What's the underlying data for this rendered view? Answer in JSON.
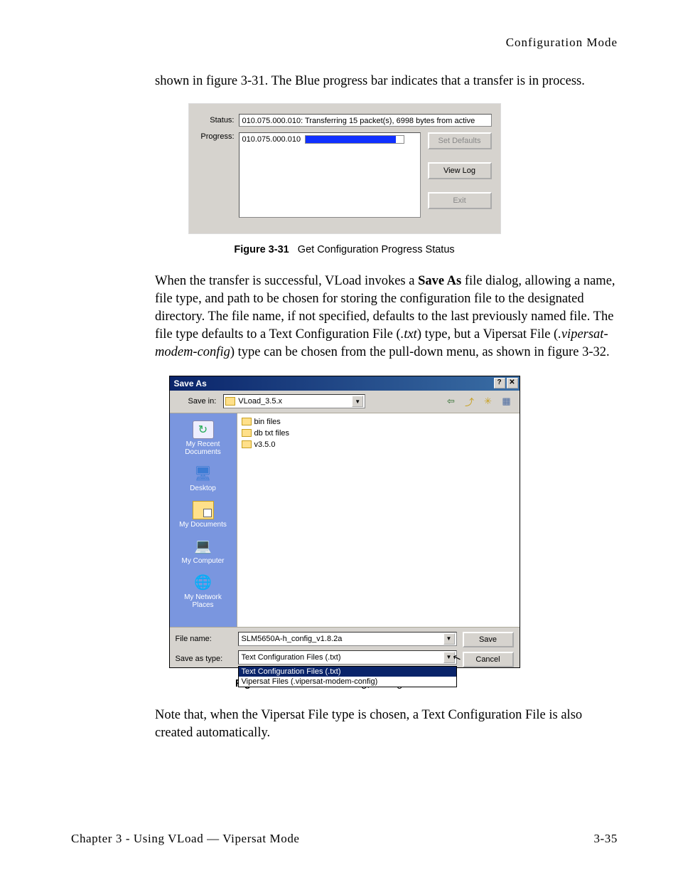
{
  "header": {
    "title": "Configuration Mode"
  },
  "paragraphs": {
    "p1": "shown in figure 3-31. The Blue progress bar indicates that a transfer is in process.",
    "p2a": "When the transfer is successful, VLoad invokes a ",
    "p2_bold": "Save As",
    "p2b": " file dialog, allowing a name, file type, and path to be chosen for storing the configuration file to the designated directory. The file name, if not specified, defaults to the last previously named file. The file type defaults to a Text Configuration File (",
    "p2_it1": ".txt",
    "p2c": ") type, but a Vipersat File (",
    "p2_it2": ".vipersat-modem-config",
    "p2d": ") type can be chosen from the pull-down menu, as shown in figure 3-32.",
    "p3": "Note that, when the Vipersat File type is chosen, a Text Configuration File is also created automatically."
  },
  "fig31": {
    "caption_num": "Figure 3-31",
    "caption_text": "Get Configuration Progress Status",
    "labels": {
      "status": "Status:",
      "progress": "Progress:"
    },
    "status_value": "010.075.000.010: Transferring 15 packet(s), 6998 bytes from active",
    "progress_ip": "010.075.000.010",
    "buttons": {
      "set_defaults": "Set Defaults",
      "view_log": "View Log",
      "exit": "Exit"
    }
  },
  "fig32": {
    "caption_num": "Figure 3-32",
    "caption_text": "Save As dialog, Configuration File",
    "title": "Save As",
    "titlebtns": {
      "help": "?",
      "close": "✕"
    },
    "toolbar": {
      "save_in_label": "Save in:",
      "save_in_value": "VLoad_3.5.x",
      "nav": {
        "back": "⇦",
        "up": "⤴",
        "newfolder": "✳",
        "views": "▦"
      }
    },
    "places": [
      {
        "label": "My Recent Documents"
      },
      {
        "label": "Desktop"
      },
      {
        "label": "My Documents"
      },
      {
        "label": "My Computer"
      },
      {
        "label": "My Network Places"
      }
    ],
    "files": [
      {
        "name": "bin files"
      },
      {
        "name": "db txt files"
      },
      {
        "name": "v3.5.0"
      }
    ],
    "bottom": {
      "filename_label": "File name:",
      "filename_value": "SLM5650A-h_config_v1.8.2a",
      "type_label": "Save as type:",
      "type_value": "Text Configuration Files (.txt)",
      "options": [
        "Text Configuration Files (.txt)",
        "Vipersat Files (.vipersat-modem-config)"
      ],
      "save": "Save",
      "cancel": "Cancel"
    }
  },
  "footer": {
    "left": "Chapter 3 - Using VLoad — Vipersat Mode",
    "right": "3-35"
  }
}
